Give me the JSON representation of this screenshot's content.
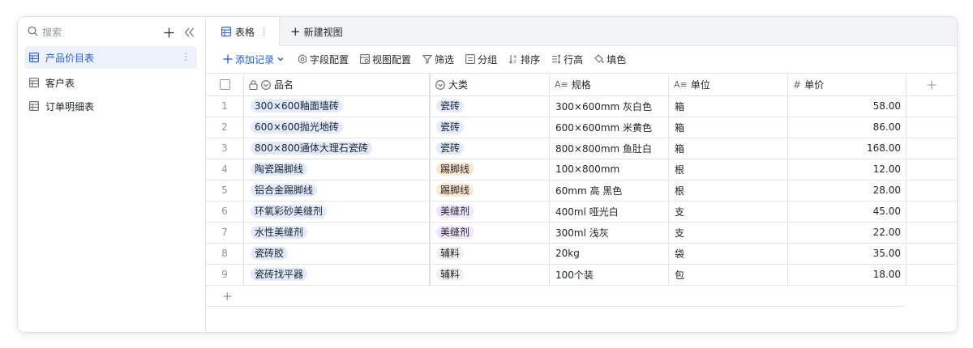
{
  "sidebar": {
    "search_placeholder": "搜索",
    "items": [
      {
        "label": "产品价目表",
        "active": true
      },
      {
        "label": "客户表",
        "active": false
      },
      {
        "label": "订单明细表",
        "active": false
      }
    ]
  },
  "tabs": {
    "active_label": "表格",
    "new_view_label": "新建视图"
  },
  "toolbar": {
    "add_record": "添加记录",
    "field_config": "字段配置",
    "view_config": "视图配置",
    "filter": "筛选",
    "group": "分组",
    "sort": "排序",
    "row_height": "行高",
    "fill_color": "填色"
  },
  "table": {
    "columns": [
      "品名",
      "大类",
      "规格",
      "单位",
      "单价"
    ],
    "rows": [
      {
        "idx": "1",
        "name": "300×600釉面墙砖",
        "category": "瓷砖",
        "spec": "300×600mm 灰白色",
        "unit": "箱",
        "price": "58.00"
      },
      {
        "idx": "2",
        "name": "600×600抛光地砖",
        "category": "瓷砖",
        "spec": "600×600mm 米黄色",
        "unit": "箱",
        "price": "86.00"
      },
      {
        "idx": "3",
        "name": "800×800通体大理石瓷砖",
        "category": "瓷砖",
        "spec": "800×800mm 鱼肚白",
        "unit": "箱",
        "price": "168.00"
      },
      {
        "idx": "4",
        "name": "陶瓷踢脚线",
        "category": "踢脚线",
        "spec": "100×800mm",
        "unit": "根",
        "price": "12.00"
      },
      {
        "idx": "5",
        "name": "铝合金踢脚线",
        "category": "踢脚线",
        "spec": "60mm 高 黑色",
        "unit": "根",
        "price": "28.00"
      },
      {
        "idx": "6",
        "name": "环氧彩砂美缝剂",
        "category": "美缝剂",
        "spec": "400ml 哑光白",
        "unit": "支",
        "price": "45.00"
      },
      {
        "idx": "7",
        "name": "水性美缝剂",
        "category": "美缝剂",
        "spec": "300ml 浅灰",
        "unit": "支",
        "price": "22.00"
      },
      {
        "idx": "8",
        "name": "瓷砖胶",
        "category": "辅料",
        "spec": "20kg",
        "unit": "袋",
        "price": "35.00"
      },
      {
        "idx": "9",
        "name": "瓷砖找平器",
        "category": "辅料",
        "spec": "100个装",
        "unit": "包",
        "price": "18.00"
      }
    ]
  },
  "category_colors": {
    "瓷砖": {
      "bg": "#e1eaff",
      "fg": "#1f2329"
    },
    "踢脚线": {
      "bg": "#fee7cd",
      "fg": "#1f2329"
    },
    "美缝剂": {
      "bg": "#efe6fe",
      "fg": "#1f2329"
    },
    "辅料": {
      "bg": "#eff0f1",
      "fg": "#1f2329"
    }
  },
  "colors": {
    "accent": "#245bdb",
    "active_bg": "#edf1fb",
    "name_pill_bg": "#e1eaff"
  }
}
